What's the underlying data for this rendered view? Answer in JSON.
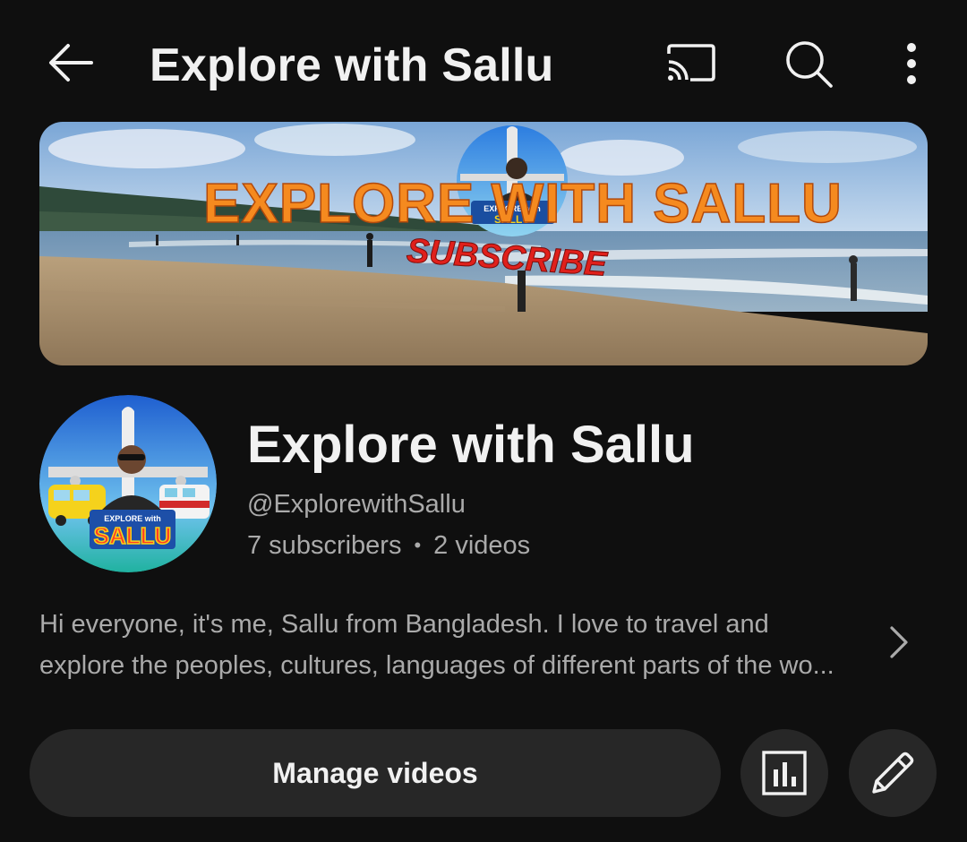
{
  "topbar": {
    "title": "Explore with Sallu",
    "icons": [
      "back-arrow-icon",
      "cast-icon",
      "search-icon",
      "more-vert-icon"
    ]
  },
  "banner": {
    "headline": "EXPLORE WITH SALLU",
    "subscribe_text": "SUBSCRIBE",
    "badge_text": "EXPLORE with",
    "badge_name": "SALLU"
  },
  "channel": {
    "name": "Explore with Sallu",
    "handle": "@ExplorewithSallu",
    "subscribers": "7 subscribers",
    "separator": "•",
    "videos": "2 videos",
    "avatar_badge_text": "EXPLORE with",
    "avatar_badge_name": "SALLU"
  },
  "description": {
    "line1": "Hi everyone, it's me, Sallu from Bangladesh. I love to travel and",
    "line2": "explore the peoples, cultures, languages of different parts of the wo..."
  },
  "actions": {
    "manage_label": "Manage videos",
    "analytics_icon": "analytics-icon",
    "edit_icon": "edit-pencil-icon"
  },
  "colors": {
    "background": "#0f0f0f",
    "button_bg": "#272727",
    "text_primary": "#f1f1f1",
    "text_secondary": "#aaaaaa",
    "banner_text_orange": "#f58a1f",
    "subscribe_red": "#e0201b"
  }
}
